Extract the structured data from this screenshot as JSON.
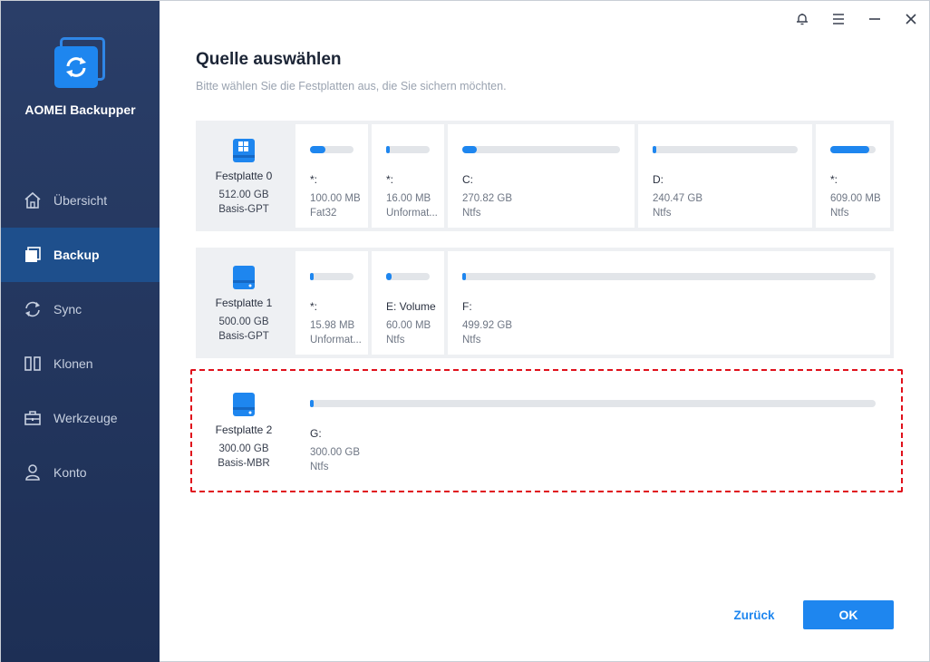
{
  "app": {
    "name": "AOMEI Backupper"
  },
  "sidebar": {
    "items": [
      {
        "label": "Übersicht",
        "icon": "home-icon",
        "active": false
      },
      {
        "label": "Backup",
        "icon": "backup-icon",
        "active": true
      },
      {
        "label": "Sync",
        "icon": "sync-icon",
        "active": false
      },
      {
        "label": "Klonen",
        "icon": "clone-icon",
        "active": false
      },
      {
        "label": "Werkzeuge",
        "icon": "toolbox-icon",
        "active": false
      },
      {
        "label": "Konto",
        "icon": "user-icon",
        "active": false
      }
    ]
  },
  "titlebar": {
    "icons": [
      "bell-icon",
      "menu-icon",
      "minimize-icon",
      "close-icon"
    ]
  },
  "main": {
    "title": "Quelle auswählen",
    "subtitle": "Bitte wählen Sie die Festplatten aus, die Sie sichern möchten."
  },
  "disks": [
    {
      "name": "Festplatte 0",
      "size": "512.00 GB",
      "type": "Basis-GPT",
      "icon": "windows-disk-icon",
      "partitions": [
        {
          "name": "*:",
          "size": "100.00 MB",
          "fs": "Fat32",
          "used": 0.35
        },
        {
          "name": "*:",
          "size": "16.00 MB",
          "fs": "Unformat...",
          "used": 0.05
        },
        {
          "name": "C:",
          "size": "270.82 GB",
          "fs": "Ntfs",
          "used": 0.09
        },
        {
          "name": "D:",
          "size": "240.47 GB",
          "fs": "Ntfs",
          "used": 0.02
        },
        {
          "name": "*:",
          "size": "609.00 MB",
          "fs": "Ntfs",
          "used": 0.85
        }
      ]
    },
    {
      "name": "Festplatte 1",
      "size": "500.00 GB",
      "type": "Basis-GPT",
      "icon": "disk-icon",
      "partitions": [
        {
          "name": "*:",
          "size": "15.98 MB",
          "fs": "Unformat...",
          "used": 0.05
        },
        {
          "name": "E: Volume",
          "size": "60.00 MB",
          "fs": "Ntfs",
          "used": 0.12
        },
        {
          "name": "F:",
          "size": "499.92 GB",
          "fs": "Ntfs",
          "used": 0.005
        }
      ]
    },
    {
      "name": "Festplatte 2",
      "size": "300.00 GB",
      "type": "Basis-MBR",
      "icon": "disk-icon",
      "partitions": [
        {
          "name": "G:",
          "size": "300.00 GB",
          "fs": "Ntfs",
          "used": 0.005
        }
      ]
    }
  ],
  "buttons": {
    "back": "Zurück",
    "ok": "OK"
  },
  "colors": {
    "accent": "#1e86ef",
    "sidebar": "#23375f",
    "selection_border": "#e0101b"
  }
}
